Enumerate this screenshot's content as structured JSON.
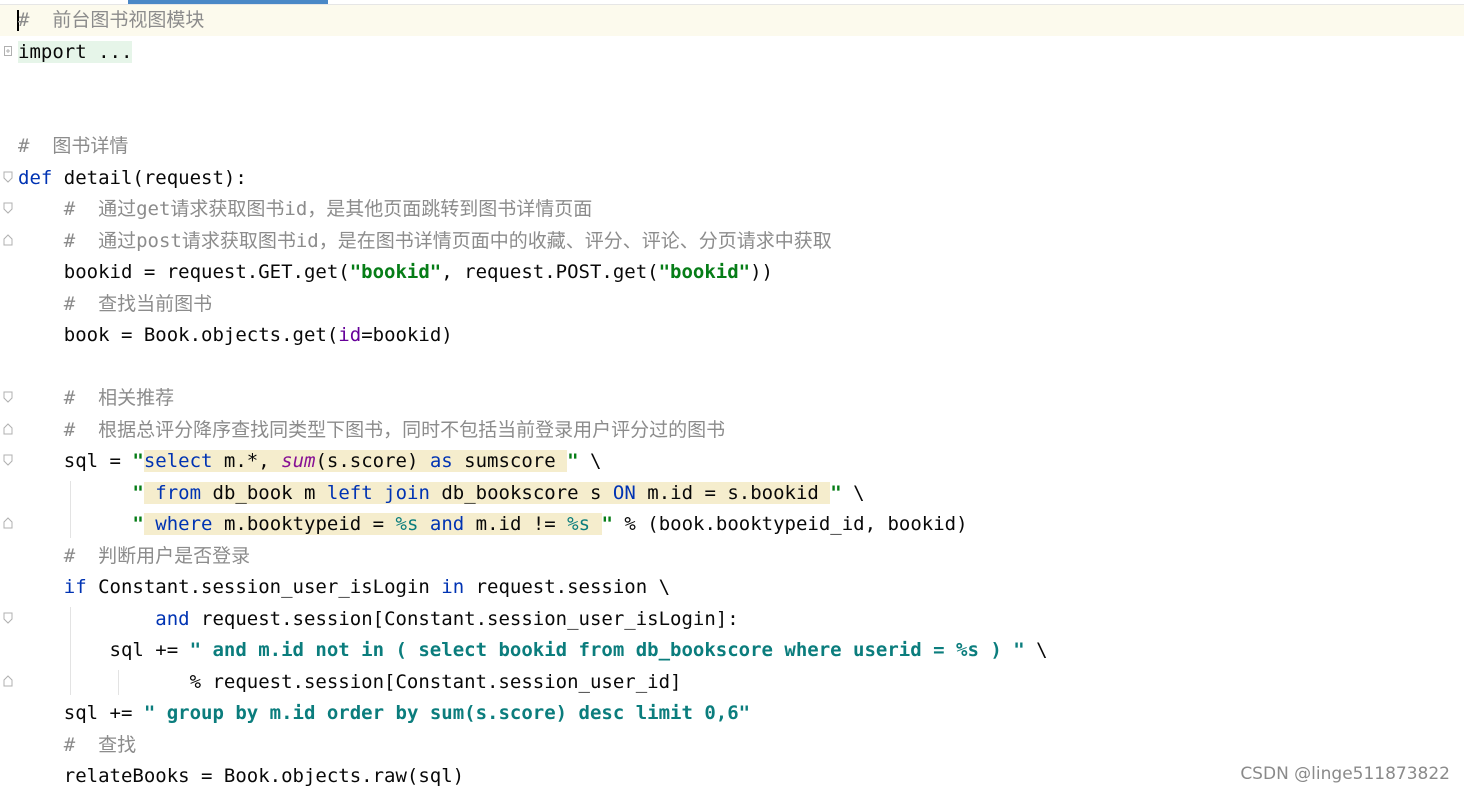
{
  "editor": {
    "lines": [
      {
        "fold": "",
        "current": true,
        "tokens": [
          {
            "t": "#  前台图书视图模块",
            "c": "cm"
          }
        ]
      },
      {
        "fold": "plus",
        "tokens": [
          {
            "t": "import ...",
            "c": "kw-fold"
          }
        ]
      },
      {
        "fold": "",
        "tokens": []
      },
      {
        "fold": "",
        "tokens": []
      },
      {
        "fold": "",
        "tokens": [
          {
            "t": "#  图书详情",
            "c": "cm"
          }
        ]
      },
      {
        "fold": "open",
        "tokens": [
          {
            "t": "def",
            "c": "kw"
          },
          {
            "t": " detail(request):",
            "c": ""
          }
        ]
      },
      {
        "fold": "open",
        "tokens": [
          {
            "t": "    ",
            "c": ""
          },
          {
            "t": "#  通过get请求获取图书id，是其他页面跳转到图书详情页面",
            "c": "cm"
          }
        ]
      },
      {
        "fold": "close",
        "tokens": [
          {
            "t": "    ",
            "c": ""
          },
          {
            "t": "#  通过post请求获取图书id，是在图书详情页面中的收藏、评分、评论、分页请求中获取",
            "c": "cm"
          }
        ]
      },
      {
        "fold": "",
        "tokens": [
          {
            "t": "    bookid = request.GET.get(",
            "c": ""
          },
          {
            "t": "\"bookid\"",
            "c": "str"
          },
          {
            "t": ", request.POST.get(",
            "c": ""
          },
          {
            "t": "\"bookid\"",
            "c": "str"
          },
          {
            "t": "))",
            "c": ""
          }
        ]
      },
      {
        "fold": "",
        "tokens": [
          {
            "t": "    ",
            "c": ""
          },
          {
            "t": "#  查找当前图书",
            "c": "cm"
          }
        ]
      },
      {
        "fold": "",
        "tokens": [
          {
            "t": "    book = Book.objects.get(",
            "c": ""
          },
          {
            "t": "id",
            "c": "param"
          },
          {
            "t": "=bookid)",
            "c": ""
          }
        ]
      },
      {
        "fold": "",
        "tokens": []
      },
      {
        "fold": "open",
        "tokens": [
          {
            "t": "    ",
            "c": ""
          },
          {
            "t": "#  相关推荐",
            "c": "cm"
          }
        ]
      },
      {
        "fold": "close",
        "tokens": [
          {
            "t": "    ",
            "c": ""
          },
          {
            "t": "#  根据总评分降序查找同类型下图书，同时不包括当前登录用户评分过的图书",
            "c": "cm"
          }
        ]
      },
      {
        "fold": "open",
        "tokens": [
          {
            "t": "    sql = ",
            "c": ""
          },
          {
            "t": "\"",
            "c": "str"
          },
          {
            "t": "select",
            "c": "sqlkw inj"
          },
          {
            "t": " m.*, ",
            "c": "inj"
          },
          {
            "t": "sum",
            "c": "fn inj"
          },
          {
            "t": "(s.score) ",
            "c": "inj"
          },
          {
            "t": "as",
            "c": "sqlkw inj"
          },
          {
            "t": " sumscore ",
            "c": "inj"
          },
          {
            "t": "\"",
            "c": "str"
          },
          {
            "t": " \\",
            "c": ""
          }
        ]
      },
      {
        "fold": "",
        "tokens": [
          {
            "t": "          ",
            "c": ""
          },
          {
            "t": "\"",
            "c": "str"
          },
          {
            "t": " ",
            "c": "inj"
          },
          {
            "t": "from",
            "c": "sqlkw inj"
          },
          {
            "t": " db_book m ",
            "c": "inj"
          },
          {
            "t": "left",
            "c": "sqlkw inj"
          },
          {
            "t": " ",
            "c": "inj"
          },
          {
            "t": "join",
            "c": "sqlkw inj"
          },
          {
            "t": " db_bookscore s ",
            "c": "inj"
          },
          {
            "t": "ON",
            "c": "sqlkw inj"
          },
          {
            "t": " m.id = s.bookid ",
            "c": "inj"
          },
          {
            "t": "\"",
            "c": "str"
          },
          {
            "t": " \\",
            "c": ""
          }
        ]
      },
      {
        "fold": "close",
        "tokens": [
          {
            "t": "          ",
            "c": ""
          },
          {
            "t": "\"",
            "c": "str"
          },
          {
            "t": " ",
            "c": "inj"
          },
          {
            "t": "where",
            "c": "sqlkw inj"
          },
          {
            "t": " m.booktypeid = ",
            "c": "inj"
          },
          {
            "t": "%s",
            "c": "fmt inj"
          },
          {
            "t": " ",
            "c": "inj"
          },
          {
            "t": "and",
            "c": "sqlkw inj"
          },
          {
            "t": " m.id != ",
            "c": "inj"
          },
          {
            "t": "%s",
            "c": "fmt inj"
          },
          {
            "t": " ",
            "c": "inj"
          },
          {
            "t": "\"",
            "c": "str"
          },
          {
            "t": " % (book.booktypeid_id, bookid)",
            "c": ""
          }
        ]
      },
      {
        "fold": "",
        "tokens": [
          {
            "t": "    ",
            "c": ""
          },
          {
            "t": "#  判断用户是否登录",
            "c": "cm"
          }
        ]
      },
      {
        "fold": "",
        "tokens": [
          {
            "t": "    ",
            "c": ""
          },
          {
            "t": "if",
            "c": "kw"
          },
          {
            "t": " Constant.session_user_isLogin ",
            "c": ""
          },
          {
            "t": "in",
            "c": "kw"
          },
          {
            "t": " request.session \\",
            "c": ""
          }
        ]
      },
      {
        "fold": "open",
        "tokens": [
          {
            "t": "            ",
            "c": ""
          },
          {
            "t": "and",
            "c": "kw"
          },
          {
            "t": " request.session[Constant.session_user_isLogin]:",
            "c": ""
          }
        ]
      },
      {
        "fold": "",
        "tokens": [
          {
            "t": "        sql += ",
            "c": ""
          },
          {
            "t": "\" and m.id not in ( select bookid from db_bookscore where userid = %s ) \"",
            "c": "sql"
          },
          {
            "t": " \\",
            "c": ""
          }
        ]
      },
      {
        "fold": "close",
        "tokens": [
          {
            "t": "               % request.session[Constant.session_user_id]",
            "c": ""
          }
        ]
      },
      {
        "fold": "",
        "tokens": [
          {
            "t": "    sql += ",
            "c": ""
          },
          {
            "t": "\" group by m.id order by sum(s.score) desc limit 0,6\"",
            "c": "sql"
          }
        ]
      },
      {
        "fold": "",
        "tokens": [
          {
            "t": "    ",
            "c": ""
          },
          {
            "t": "#  查找",
            "c": "cm"
          }
        ]
      },
      {
        "fold": "",
        "tokens": [
          {
            "t": "    relateBooks = Book.objects.raw(sql)",
            "c": ""
          }
        ]
      }
    ]
  },
  "watermark": "CSDN @linge511873822",
  "colors": {
    "keyword": "#0033b3",
    "comment": "#8c8c8c",
    "string": "#067d17",
    "sql_string": "#0b7d7d",
    "injection_bg": "#f5edcd",
    "current_line_bg": "#fcfaed",
    "folded_bg": "#e6f5e9"
  }
}
